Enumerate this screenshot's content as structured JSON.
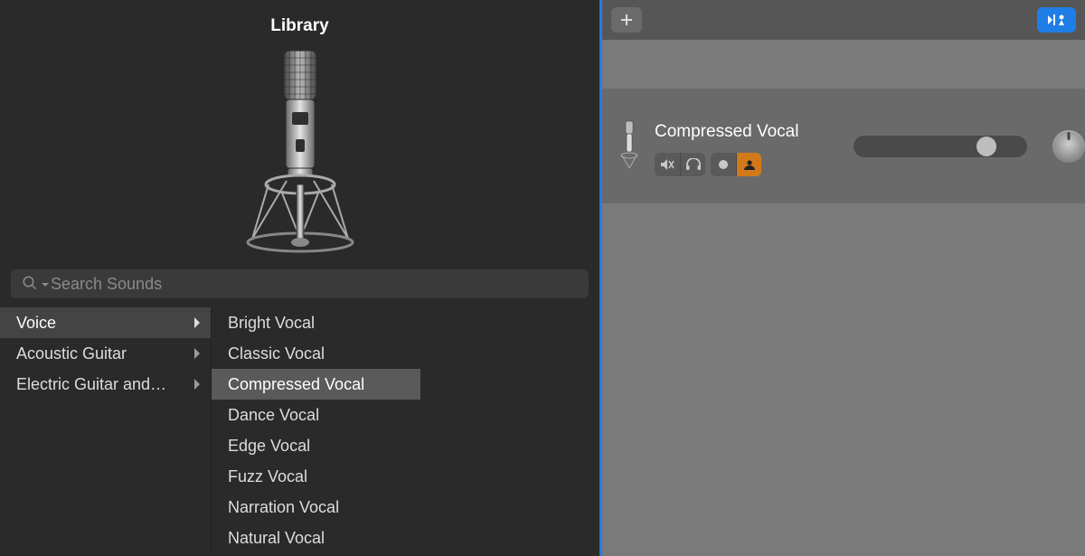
{
  "library": {
    "title": "Library",
    "search_placeholder": "Search Sounds",
    "selected_category": 0,
    "selected_preset": 2,
    "categories": [
      {
        "label": "Voice",
        "has_children": true
      },
      {
        "label": "Acoustic Guitar",
        "has_children": true
      },
      {
        "label": "Electric Guitar and…",
        "has_children": true
      }
    ],
    "presets": [
      {
        "label": "Bright Vocal"
      },
      {
        "label": "Classic Vocal"
      },
      {
        "label": "Compressed Vocal"
      },
      {
        "label": "Dance Vocal"
      },
      {
        "label": "Edge Vocal"
      },
      {
        "label": "Fuzz Vocal"
      },
      {
        "label": "Narration Vocal"
      },
      {
        "label": "Natural Vocal"
      }
    ]
  },
  "tracks": {
    "items": [
      {
        "name": "Compressed Vocal",
        "mute": false,
        "solo": false,
        "record_armed": true,
        "volume_percent": 70
      }
    ]
  },
  "icons": {
    "mute": "mute-icon",
    "headphones": "headphones-icon",
    "record": "record-dot-icon",
    "input_monitor": "input-monitor-icon",
    "plus": "plus-icon",
    "catch_playhead": "catch-playhead-icon",
    "search": "search-icon"
  },
  "colors": {
    "accent_blue": "#1f7de6",
    "accent_orange": "#d27a1a"
  }
}
